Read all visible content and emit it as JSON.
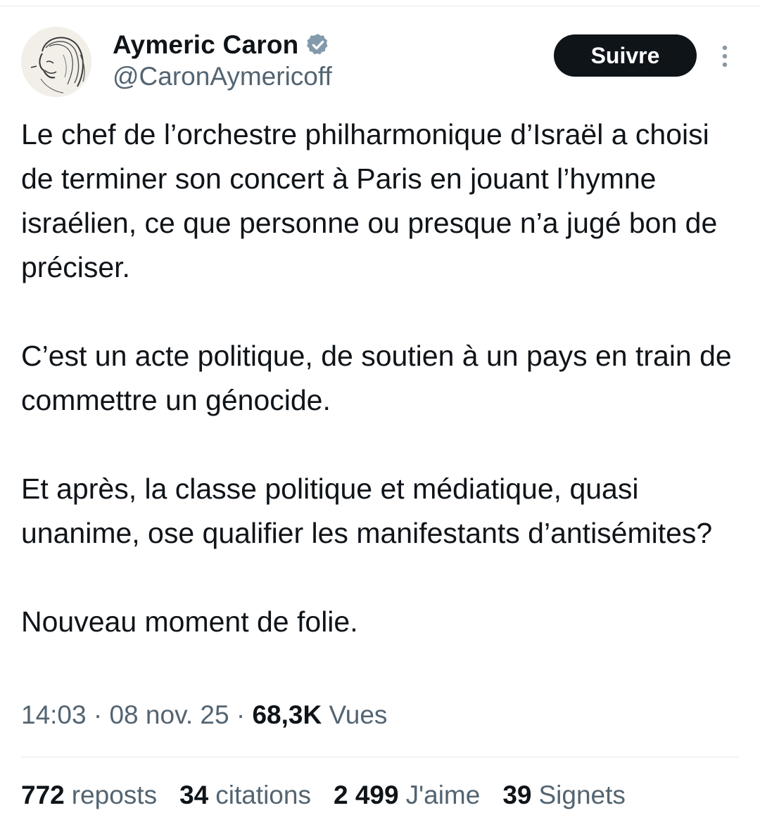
{
  "author": {
    "display_name": "Aymeric Caron",
    "handle": "@CaronAymericoff",
    "verified": true,
    "verified_color": "#829aab"
  },
  "actions": {
    "follow_label": "Suivre"
  },
  "tweet": {
    "paragraphs": [
      "Le chef de l’orchestre philharmonique d’Israël a choisi de terminer son concert à Paris en jouant l’hymne israélien, ce que personne ou presque n’a jugé bon de préciser.",
      "C’est un acte politique, de soutien à un pays en train de commettre un génocide.",
      "Et après, la classe politique et médiatique, quasi unanime, ose qualifier les manifestants d’antisémites?",
      "Nouveau moment de folie."
    ]
  },
  "meta": {
    "time": "14:03",
    "separator": " · ",
    "date": "08 nov. 25",
    "views_count": "68,3K",
    "views_label": "Vues"
  },
  "stats": [
    {
      "count": "772",
      "label": "reposts"
    },
    {
      "count": "34",
      "label": "citations"
    },
    {
      "count": "2 499",
      "label": "J'aime"
    },
    {
      "count": "39",
      "label": "Signets"
    }
  ],
  "colors": {
    "text_primary": "#0f1419",
    "text_secondary": "#536471",
    "divider": "#e6e9ec",
    "button_bg": "#0f1419"
  }
}
